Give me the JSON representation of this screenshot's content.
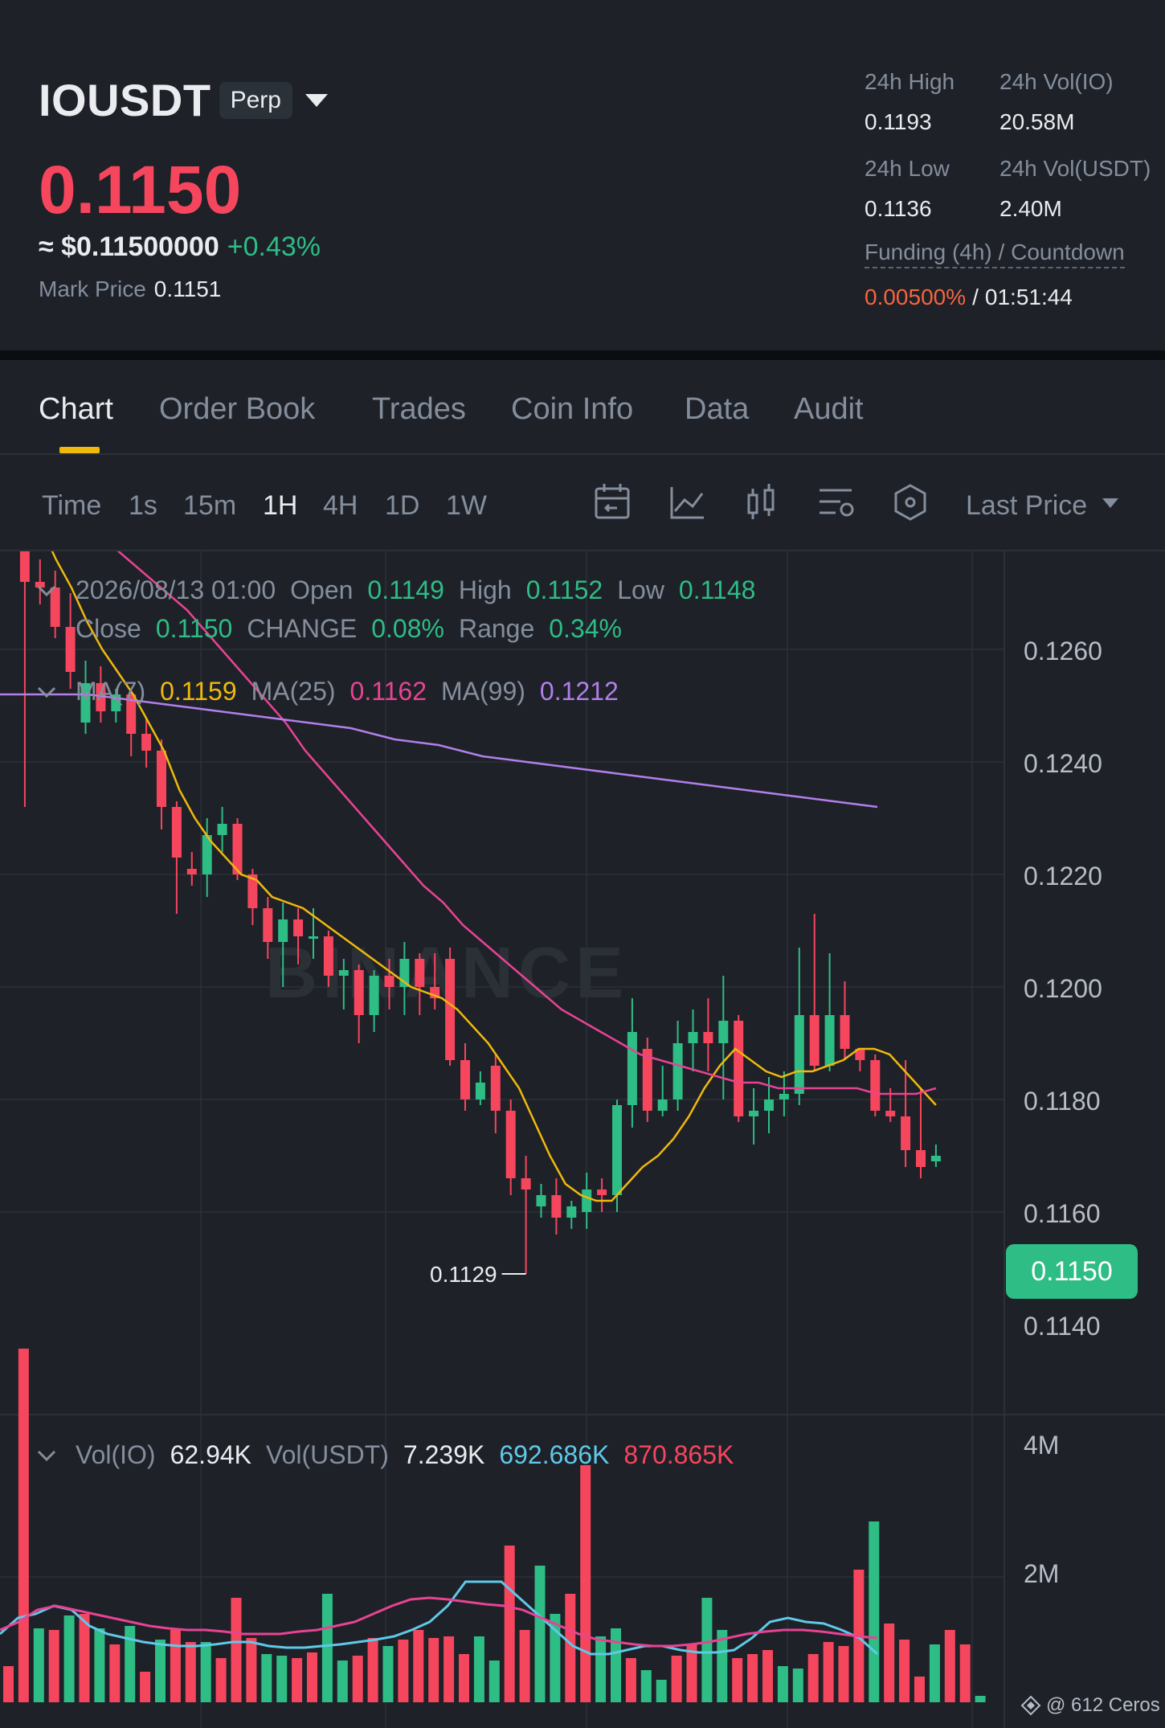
{
  "header": {
    "symbol": "IOUSDT",
    "contract_badge": "Perp",
    "last_price": "0.1150",
    "usd_price": "≈ $0.11500000",
    "change_pct": "+0.43%",
    "mark_price_label": "Mark Price",
    "mark_price": "0.1151",
    "high_24h_label": "24h High",
    "high_24h": "0.1193",
    "low_24h_label": "24h Low",
    "low_24h": "0.1136",
    "vol_io_label": "24h Vol(IO)",
    "vol_io": "20.58M",
    "vol_usdt_label": "24h Vol(USDT)",
    "vol_usdt": "2.40M",
    "funding_label": "Funding (4h) / Countdown",
    "funding_rate": "0.00500%",
    "funding_sep": "/",
    "countdown": "01:51:44"
  },
  "tabs": [
    "Chart",
    "Order Book",
    "Trades",
    "Coin Info",
    "Data",
    "Audit"
  ],
  "active_tab": "Chart",
  "toolbar": {
    "time_label": "Time",
    "intervals": [
      "1s",
      "15m",
      "1H",
      "4H",
      "1D",
      "1W"
    ],
    "active_interval": "1H",
    "price_type": "Last Price"
  },
  "ohlc": {
    "datetime": "2026/08/13 01:00",
    "open_label": "Open",
    "open": "0.1149",
    "high_label": "High",
    "high": "0.1152",
    "low_label": "Low",
    "low": "0.1148",
    "close_label": "Close",
    "close": "0.1150",
    "change_label": "CHANGE",
    "change": "0.08%",
    "range_label": "Range",
    "range": "0.34%"
  },
  "ma": {
    "ma7_label": "MA(7)",
    "ma7": "0.1159",
    "ma25_label": "MA(25)",
    "ma25": "0.1162",
    "ma99_label": "MA(99)",
    "ma99": "0.1212"
  },
  "volume_legend": {
    "vol_io_label": "Vol(IO)",
    "vol_io": "62.94K",
    "vol_usdt_label": "Vol(USDT)",
    "vol_usdt": "7.239K",
    "ma1": "692.686K",
    "ma2": "870.865K"
  },
  "watermark": "BINANCE",
  "footer": "@ 612 Ceros",
  "colors": {
    "up": "#2ebd85",
    "down": "#f6465d",
    "ma7": "#f0b90b",
    "ma25": "#e84393",
    "ma99": "#b37feb",
    "accent": "#f0b90b"
  },
  "chart_data": {
    "type": "candlestick",
    "interval": "1H",
    "y_ticks": [
      "0.1260",
      "0.1240",
      "0.1220",
      "0.1200",
      "0.1180",
      "0.1160",
      "0.1140"
    ],
    "ylim": [
      0.1125,
      0.1275
    ],
    "current_price": "0.1150",
    "high_marker": "0.1272",
    "low_marker": "0.1129",
    "candles": [
      [
        0.1263,
        0.126,
        0.1272,
        0.1259
      ],
      [
        0.126,
        0.1252,
        0.1266,
        0.1212
      ],
      [
        0.1252,
        0.1251,
        0.1256,
        0.1248
      ],
      [
        0.1251,
        0.1244,
        0.1254,
        0.1242
      ],
      [
        0.1244,
        0.1236,
        0.125,
        0.1233
      ],
      [
        0.1227,
        0.1234,
        0.1238,
        0.1225
      ],
      [
        0.1234,
        0.1229,
        0.1237,
        0.1227
      ],
      [
        0.1229,
        0.1232,
        0.1233,
        0.1227
      ],
      [
        0.1232,
        0.1225,
        0.1233,
        0.1221
      ],
      [
        0.1225,
        0.1222,
        0.1228,
        0.1219
      ],
      [
        0.1222,
        0.1212,
        0.1224,
        0.1208
      ],
      [
        0.1212,
        0.1203,
        0.1213,
        0.1193
      ],
      [
        0.1201,
        0.12,
        0.1204,
        0.1198
      ],
      [
        0.12,
        0.1207,
        0.121,
        0.1196
      ],
      [
        0.1207,
        0.1209,
        0.1212,
        0.1204
      ],
      [
        0.1209,
        0.12,
        0.121,
        0.1199
      ],
      [
        0.12,
        0.1194,
        0.1201,
        0.1191
      ],
      [
        0.1194,
        0.1188,
        0.1196,
        0.1185
      ],
      [
        0.1188,
        0.1192,
        0.1195,
        0.118
      ],
      [
        0.1192,
        0.1189,
        0.1194,
        0.1184
      ],
      [
        0.1189,
        0.1189,
        0.1194,
        0.1185
      ],
      [
        0.1189,
        0.1182,
        0.119,
        0.118
      ],
      [
        0.1182,
        0.1183,
        0.1185,
        0.1176
      ],
      [
        0.1183,
        0.1175,
        0.1184,
        0.117
      ],
      [
        0.1175,
        0.1182,
        0.1183,
        0.1172
      ],
      [
        0.1182,
        0.118,
        0.1185,
        0.1176
      ],
      [
        0.118,
        0.1185,
        0.1188,
        0.1175
      ],
      [
        0.1185,
        0.118,
        0.1186,
        0.1175
      ],
      [
        0.118,
        0.1178,
        0.1186,
        0.1176
      ],
      [
        0.1185,
        0.1167,
        0.1187,
        0.1166
      ],
      [
        0.1167,
        0.116,
        0.117,
        0.1158
      ],
      [
        0.116,
        0.1163,
        0.1165,
        0.1159
      ],
      [
        0.1166,
        0.1158,
        0.1168,
        0.1154
      ],
      [
        0.1158,
        0.1146,
        0.116,
        0.1143
      ],
      [
        0.1146,
        0.1144,
        0.115,
        0.1129
      ],
      [
        0.1141,
        0.1143,
        0.1145,
        0.1139
      ],
      [
        0.1143,
        0.1139,
        0.1146,
        0.1136
      ],
      [
        0.1139,
        0.1141,
        0.1142,
        0.1137
      ],
      [
        0.114,
        0.1144,
        0.1147,
        0.1137
      ],
      [
        0.1144,
        0.1143,
        0.1146,
        0.114
      ],
      [
        0.1143,
        0.1159,
        0.116,
        0.114
      ],
      [
        0.1159,
        0.1172,
        0.1178,
        0.1155
      ],
      [
        0.1169,
        0.1158,
        0.1171,
        0.1156
      ],
      [
        0.1158,
        0.116,
        0.1166,
        0.1157
      ],
      [
        0.116,
        0.117,
        0.1174,
        0.1158
      ],
      [
        0.117,
        0.1172,
        0.1176,
        0.1165
      ],
      [
        0.1172,
        0.117,
        0.1178,
        0.1165
      ],
      [
        0.117,
        0.1174,
        0.1182,
        0.116
      ],
      [
        0.1174,
        0.1157,
        0.1175,
        0.1156
      ],
      [
        0.1157,
        0.1158,
        0.1162,
        0.1152
      ],
      [
        0.1158,
        0.116,
        0.1164,
        0.1154
      ],
      [
        0.116,
        0.1161,
        0.1165,
        0.1157
      ],
      [
        0.1161,
        0.1175,
        0.1187,
        0.1159
      ],
      [
        0.1175,
        0.1166,
        0.1193,
        0.1165
      ],
      [
        0.1166,
        0.1175,
        0.1186,
        0.1165
      ],
      [
        0.1175,
        0.1169,
        0.1181,
        0.1167
      ],
      [
        0.1169,
        0.1167,
        0.1169,
        0.1165
      ],
      [
        0.1167,
        0.1158,
        0.1168,
        0.1157
      ],
      [
        0.1158,
        0.1157,
        0.1162,
        0.1156
      ],
      [
        0.1157,
        0.1151,
        0.1167,
        0.1148
      ],
      [
        0.1151,
        0.1148,
        0.1162,
        0.1146
      ],
      [
        0.1149,
        0.115,
        0.1152,
        0.1148
      ]
    ],
    "ma7_values": [
      0.127,
      0.1266,
      0.1262,
      0.1256,
      0.1251,
      0.1245,
      0.124,
      0.1236,
      0.1232,
      0.1227,
      0.1222,
      0.1215,
      0.121,
      0.1206,
      0.1203,
      0.12,
      0.1199,
      0.1196,
      0.1195,
      0.1194,
      0.1192,
      0.119,
      0.1188,
      0.1186,
      0.1184,
      0.1182,
      0.118,
      0.1179,
      0.1178,
      0.1176,
      0.1173,
      0.117,
      0.1166,
      0.1162,
      0.1156,
      0.115,
      0.1145,
      0.1143,
      0.1142,
      0.1142,
      0.1145,
      0.1148,
      0.115,
      0.1153,
      0.1157,
      0.1162,
      0.1166,
      0.1169,
      0.1167,
      0.1165,
      0.1164,
      0.1165,
      0.1165,
      0.1166,
      0.1167,
      0.1169,
      0.1169,
      0.1168,
      0.1165,
      0.1162,
      0.1159
    ],
    "ma25_values": [
      0.1272,
      0.127,
      0.1268,
      0.1265,
      0.1262,
      0.1259,
      0.1256,
      0.1253,
      0.125,
      0.1247,
      0.1243,
      0.1239,
      0.1235,
      0.1231,
      0.1227,
      0.1222,
      0.1218,
      0.1214,
      0.121,
      0.1206,
      0.1202,
      0.1198,
      0.1195,
      0.1191,
      0.1188,
      0.1185,
      0.1182,
      0.1179,
      0.1176,
      0.1174,
      0.1172,
      0.117,
      0.1168,
      0.1167,
      0.1166,
      0.1165,
      0.1164,
      0.1163,
      0.1163,
      0.1162,
      0.1162,
      0.1162,
      0.1162,
      0.1162,
      0.1161,
      0.1161,
      0.1161,
      0.1162
    ],
    "ma99_values": [
      0.1232,
      0.1232,
      0.1232,
      0.1231,
      0.123,
      0.1229,
      0.1228,
      0.1227,
      0.1226,
      0.1224,
      0.1223,
      0.1221,
      0.122,
      0.1219,
      0.1218,
      0.1217,
      0.1216,
      0.1215,
      0.1214,
      0.1213,
      0.1212
    ],
    "volume_ticks": [
      "4M",
      "2M"
    ],
    "volume_values": [
      0.45,
      4.4,
      0.92,
      0.9,
      1.08,
      1.1,
      0.92,
      0.72,
      0.95,
      0.38,
      0.78,
      0.9,
      0.75,
      0.75,
      0.55,
      1.3,
      0.8,
      0.6,
      0.58,
      0.55,
      0.62,
      1.35,
      0.52,
      0.58,
      0.8,
      0.7,
      0.78,
      0.9,
      0.8,
      0.82,
      0.6,
      0.82,
      0.52,
      1.95,
      0.9,
      1.7,
      1.1,
      1.35,
      2.95,
      0.82,
      0.92,
      0.55,
      0.4,
      0.28,
      0.58,
      0.72,
      1.3,
      0.9,
      0.55,
      0.6,
      0.65,
      0.45,
      0.42,
      0.6,
      0.75,
      0.7,
      1.65,
      2.25,
      0.98,
      0.78,
      0.32,
      0.72,
      0.9,
      0.72,
      0.08
    ],
    "volume_up": [
      false,
      false,
      true,
      false,
      true,
      false,
      true,
      false,
      true,
      false,
      true,
      false,
      false,
      true,
      false,
      false,
      false,
      true,
      true,
      false,
      false,
      true,
      true,
      false,
      false,
      true,
      false,
      false,
      false,
      false,
      false,
      true,
      true,
      false,
      false,
      true,
      true,
      false,
      false,
      true,
      true,
      false,
      true,
      true,
      false,
      false,
      true,
      true,
      false,
      false,
      false,
      true,
      true,
      false,
      false,
      false,
      false,
      true,
      false,
      false,
      false,
      true,
      false,
      false,
      true
    ],
    "vol_ma1_values": [
      0.85,
      1.05,
      1.1,
      1.2,
      1.15,
      0.95,
      0.85,
      0.8,
      0.75,
      0.72,
      0.7,
      0.7,
      0.72,
      0.75,
      0.75,
      0.7,
      0.68,
      0.68,
      0.7,
      0.72,
      0.75,
      0.78,
      0.82,
      0.9,
      1.0,
      1.2,
      1.5,
      1.5,
      1.5,
      1.3,
      1.1,
      0.9,
      0.7,
      0.6,
      0.6,
      0.65,
      0.7,
      0.7,
      0.65,
      0.62,
      0.62,
      0.65,
      0.8,
      1.0,
      1.05,
      1.0,
      0.98,
      0.9,
      0.8,
      0.6
    ],
    "vol_ma2_values": [
      0.9,
      1.0,
      1.15,
      1.2,
      1.15,
      1.1,
      1.05,
      1.0,
      0.95,
      0.92,
      0.9,
      0.9,
      0.88,
      0.85,
      0.85,
      0.85,
      0.88,
      0.9,
      0.95,
      1.0,
      1.1,
      1.2,
      1.28,
      1.3,
      1.28,
      1.25,
      1.22,
      1.2,
      1.15,
      1.05,
      0.95,
      0.85,
      0.78,
      0.75,
      0.72,
      0.7,
      0.7,
      0.72,
      0.75,
      0.8,
      0.85,
      0.88,
      0.9,
      0.9,
      0.88,
      0.85,
      0.82,
      0.8
    ]
  }
}
